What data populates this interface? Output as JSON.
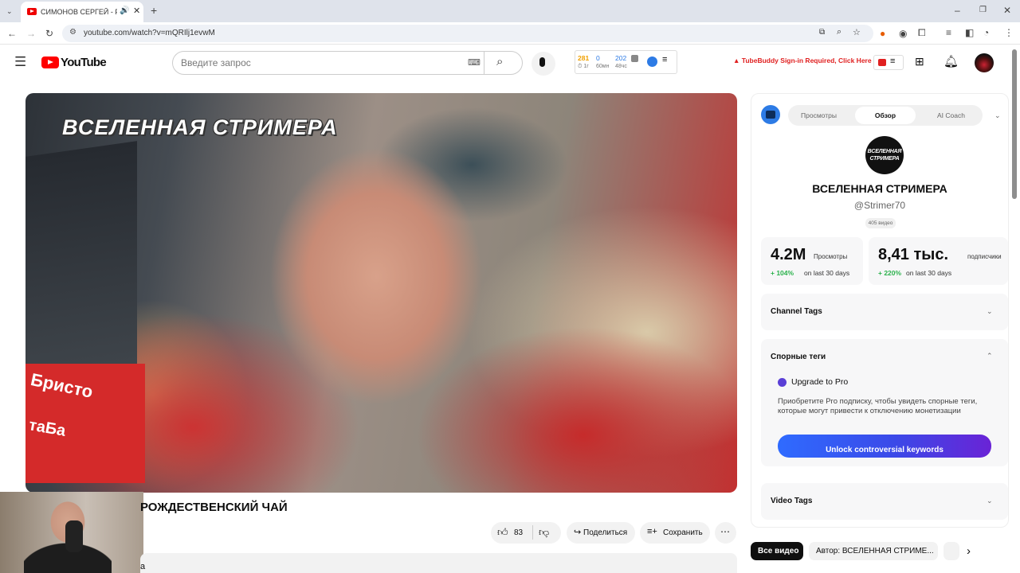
{
  "browser": {
    "tab_title": "СИМОНОВ СЕРГЕЙ - РОЖ",
    "url": "youtube.com/watch?v=mQRIlj1evwM"
  },
  "youtube": {
    "logo_text": "YouTube",
    "search_placeholder": "Введите запрос",
    "stats": {
      "views_1h": "281",
      "label_1h": "1г",
      "views_60m": "0",
      "label_60m": "60мн",
      "views_48h": "202",
      "label_48h": "48чс"
    },
    "tubebuddy_warning": "TubeBuddy Sign-in Required, Click Here"
  },
  "video": {
    "overlay_title": "ВСЕЛЕННАЯ СТРИМЕРА",
    "sign_text_1": "Бристо",
    "sign_text_2": "таБа",
    "title": "РОЖДЕСТВЕНСКИЙ ЧАЙ",
    "like_count": "83",
    "share_label": "Поделиться",
    "save_label": "Сохранить",
    "desc_fragment": "а"
  },
  "panel": {
    "tabs": [
      "Просмотры",
      "Обзор",
      "AI Coach"
    ],
    "active_tab": "Обзор",
    "avatar_text": "ВСЕЛЕННАЯ СТРИМЕРА",
    "channel_name": "ВСЕЛЕННАЯ СТРИМЕРА",
    "channel_handle": "@Strimer70",
    "video_count": "405 видео",
    "views_value": "4.2M",
    "views_label": "Просмотры",
    "views_change": "+ 104%",
    "views_period": "on last 30 days",
    "subs_value": "8,41 тыс.",
    "subs_label": "подписчики",
    "subs_change": "+ 220%",
    "subs_period": "on last 30 days",
    "channel_tags": "Channel Tags",
    "controversial_tags": "Спорные теги",
    "upgrade_title": "Upgrade to Pro",
    "upgrade_text": "Приобретите Pro подписку, чтобы увидеть спорные теги, которые могут привести к отключению монетизации",
    "unlock_button": "Unlock controversial keywords",
    "video_tags": "Video Tags"
  },
  "chips": {
    "all_videos": "Все видео",
    "author": "Автор: ВСЕЛЕННАЯ СТРИМЕ..."
  },
  "colors": {
    "youtube_red": "#ff0000",
    "positive_green": "#2bb24c",
    "warning_red": "#e02020",
    "stats_blue": "#2d7be5",
    "stats_orange": "#f0a000"
  }
}
